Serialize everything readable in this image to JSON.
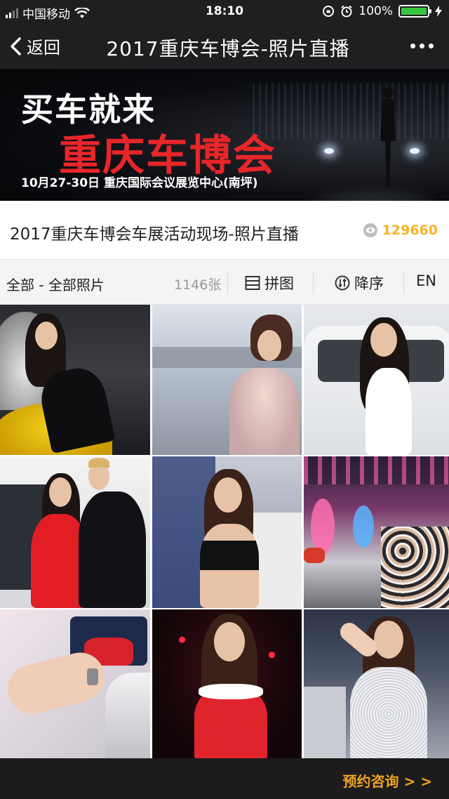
{
  "status_bar": {
    "carrier": "中国移动",
    "time": "18:10",
    "battery": "100%",
    "battery_level": 1.0
  },
  "nav": {
    "back_label": "返回",
    "title": "2017重庆车博会-照片直播"
  },
  "banner": {
    "line1": "买车就来",
    "line2": "重庆车博会",
    "line3": "10月27-30日  重庆国际会议展览中心(南坪)"
  },
  "album": {
    "title": "2017重庆车博会车展活动现场-照片直播",
    "views": "129660"
  },
  "filter": {
    "category": "全部 - 全部照片",
    "count": "1146张",
    "collage_label": "拼图",
    "sort_label": "降序",
    "lang_label": "EN"
  },
  "photos": [
    {
      "id": "p1"
    },
    {
      "id": "p2"
    },
    {
      "id": "p3"
    },
    {
      "id": "p4"
    },
    {
      "id": "p5"
    },
    {
      "id": "p6"
    },
    {
      "id": "p7"
    },
    {
      "id": "p8"
    },
    {
      "id": "p9"
    }
  ],
  "footer": {
    "consult_label": "预约咨询 > >"
  },
  "colors": {
    "bar_bg": "#1f1f21",
    "accent_gold": "#f5b428",
    "banner_red": "#e8262a",
    "consult_orange": "#f0a41f",
    "battery_green": "#36c73f"
  }
}
